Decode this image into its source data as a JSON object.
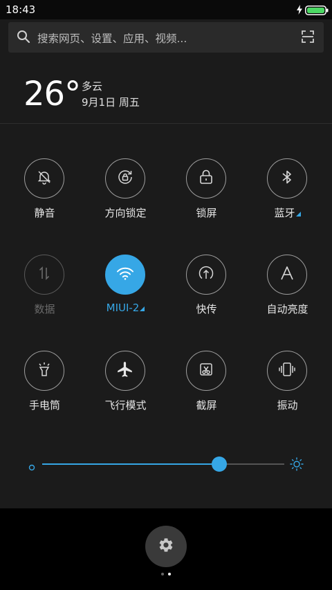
{
  "status_bar": {
    "time": "18:43"
  },
  "search": {
    "placeholder": "搜索网页、设置、应用、视频..."
  },
  "weather": {
    "temperature": "26°",
    "condition": "多云",
    "date": "9月1日 周五"
  },
  "toggles": [
    {
      "label": "静音",
      "icon": "bell-off-icon",
      "state": "off"
    },
    {
      "label": "方向锁定",
      "icon": "rotation-lock-icon",
      "state": "off"
    },
    {
      "label": "锁屏",
      "icon": "lock-icon",
      "state": "off"
    },
    {
      "label": "蓝牙",
      "icon": "bluetooth-icon",
      "state": "off"
    },
    {
      "label": "数据",
      "icon": "mobile-data-icon",
      "state": "disabled"
    },
    {
      "label": "MIUI-2",
      "icon": "wifi-icon",
      "state": "on"
    },
    {
      "label": "快传",
      "icon": "share-upload-icon",
      "state": "off"
    },
    {
      "label": "自动亮度",
      "icon": "auto-brightness-icon",
      "state": "off"
    },
    {
      "label": "手电筒",
      "icon": "flashlight-icon",
      "state": "off"
    },
    {
      "label": "飞行模式",
      "icon": "airplane-icon",
      "state": "off"
    },
    {
      "label": "截屏",
      "icon": "screenshot-icon",
      "state": "off"
    },
    {
      "label": "振动",
      "icon": "vibrate-icon",
      "state": "off"
    }
  ],
  "brightness": {
    "level": 0.73
  },
  "pages": {
    "count": 2,
    "current": 2
  },
  "colors": {
    "accent": "#36a7e6",
    "panel": "#1b1b1b",
    "battery": "#4cd964"
  }
}
